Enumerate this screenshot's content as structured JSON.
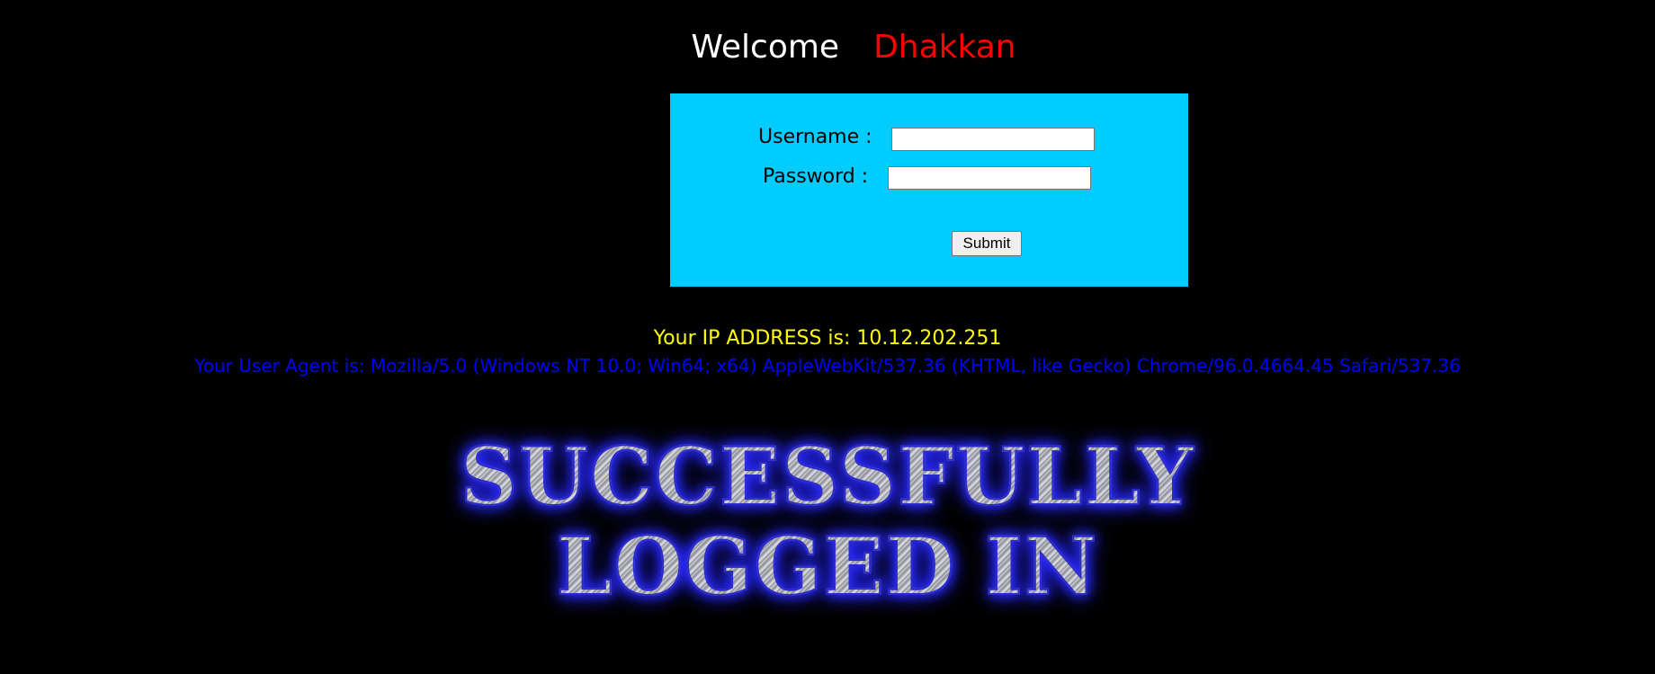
{
  "header": {
    "welcome_label": "Welcome",
    "user_name": "Dhakkan"
  },
  "login_form": {
    "username_label": "Username :",
    "username_value": "",
    "password_label": "Password :",
    "password_value": "",
    "submit_label": "Submit"
  },
  "info": {
    "ip_text": "Your IP ADDRESS is: 10.12.202.251",
    "user_agent_text": "Your User Agent is: Mozilla/5.0 (Windows NT 10.0; Win64; x64) AppleWebKit/537.36 (KHTML, like Gecko) Chrome/96.0.4664.45 Safari/537.36"
  },
  "banner": {
    "line1": "SUCCESSFULLY",
    "line2": "LOGGED IN"
  },
  "colors": {
    "background": "#000000",
    "form_background": "#00ccff",
    "welcome": "#ffffff",
    "user_name": "#ff0000",
    "ip_text": "#ffff00",
    "user_agent_text": "#0000ff"
  }
}
